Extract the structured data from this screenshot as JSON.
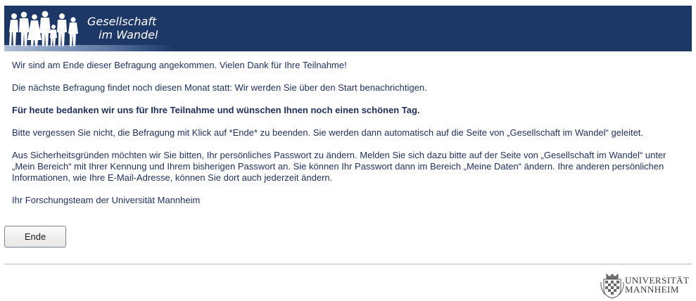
{
  "header": {
    "logo_line1": "Gesellschaft",
    "logo_line2": "im Wandel",
    "background_color": "#1d3767"
  },
  "content": {
    "p1": "Wir sind am Ende dieser Befragung angekommen. Vielen Dank für Ihre Teilnahme!",
    "p2": "Die nächste Befragung findet noch diesen Monat statt: Wir werden Sie über den Start benachrichtigen.",
    "p3": "Für heute bedanken wir uns für Ihre Teilnahme und wünschen Ihnen noch einen schönen Tag.",
    "p4": "Bitte vergessen Sie nicht, die Befragung mit Klick auf *Ende* zu beenden. Sie werden dann automatisch auf die Seite von „Gesellschaft im Wandel“ geleitet.",
    "p5": "Aus Sicherheitsgründen möchten wir Sie bitten, Ihr persönliches Passwort zu ändern. Melden Sie sich dazu bitte auf der Seite von „Gesellschaft im Wandel“ unter „Mein Bereich“ mit Ihrer Kennung und Ihrem bisherigen Passwort an. Sie können Ihr Passwort dann im Bereich „Meine Daten“ ändern. Ihre anderen persönlichen Informationen, wie Ihre E-Mail-Adresse, können Sie dort auch jederzeit ändern.",
    "p6": "Ihr Forschungsteam der Universität Mannheim",
    "text_color": "#1f2f5a"
  },
  "actions": {
    "end_button_label": "Ende"
  },
  "footer": {
    "university_line1": "UNIVERSITÄT",
    "university_line2": "MANNHEIM",
    "seal_icon": "university-seal-icon"
  }
}
